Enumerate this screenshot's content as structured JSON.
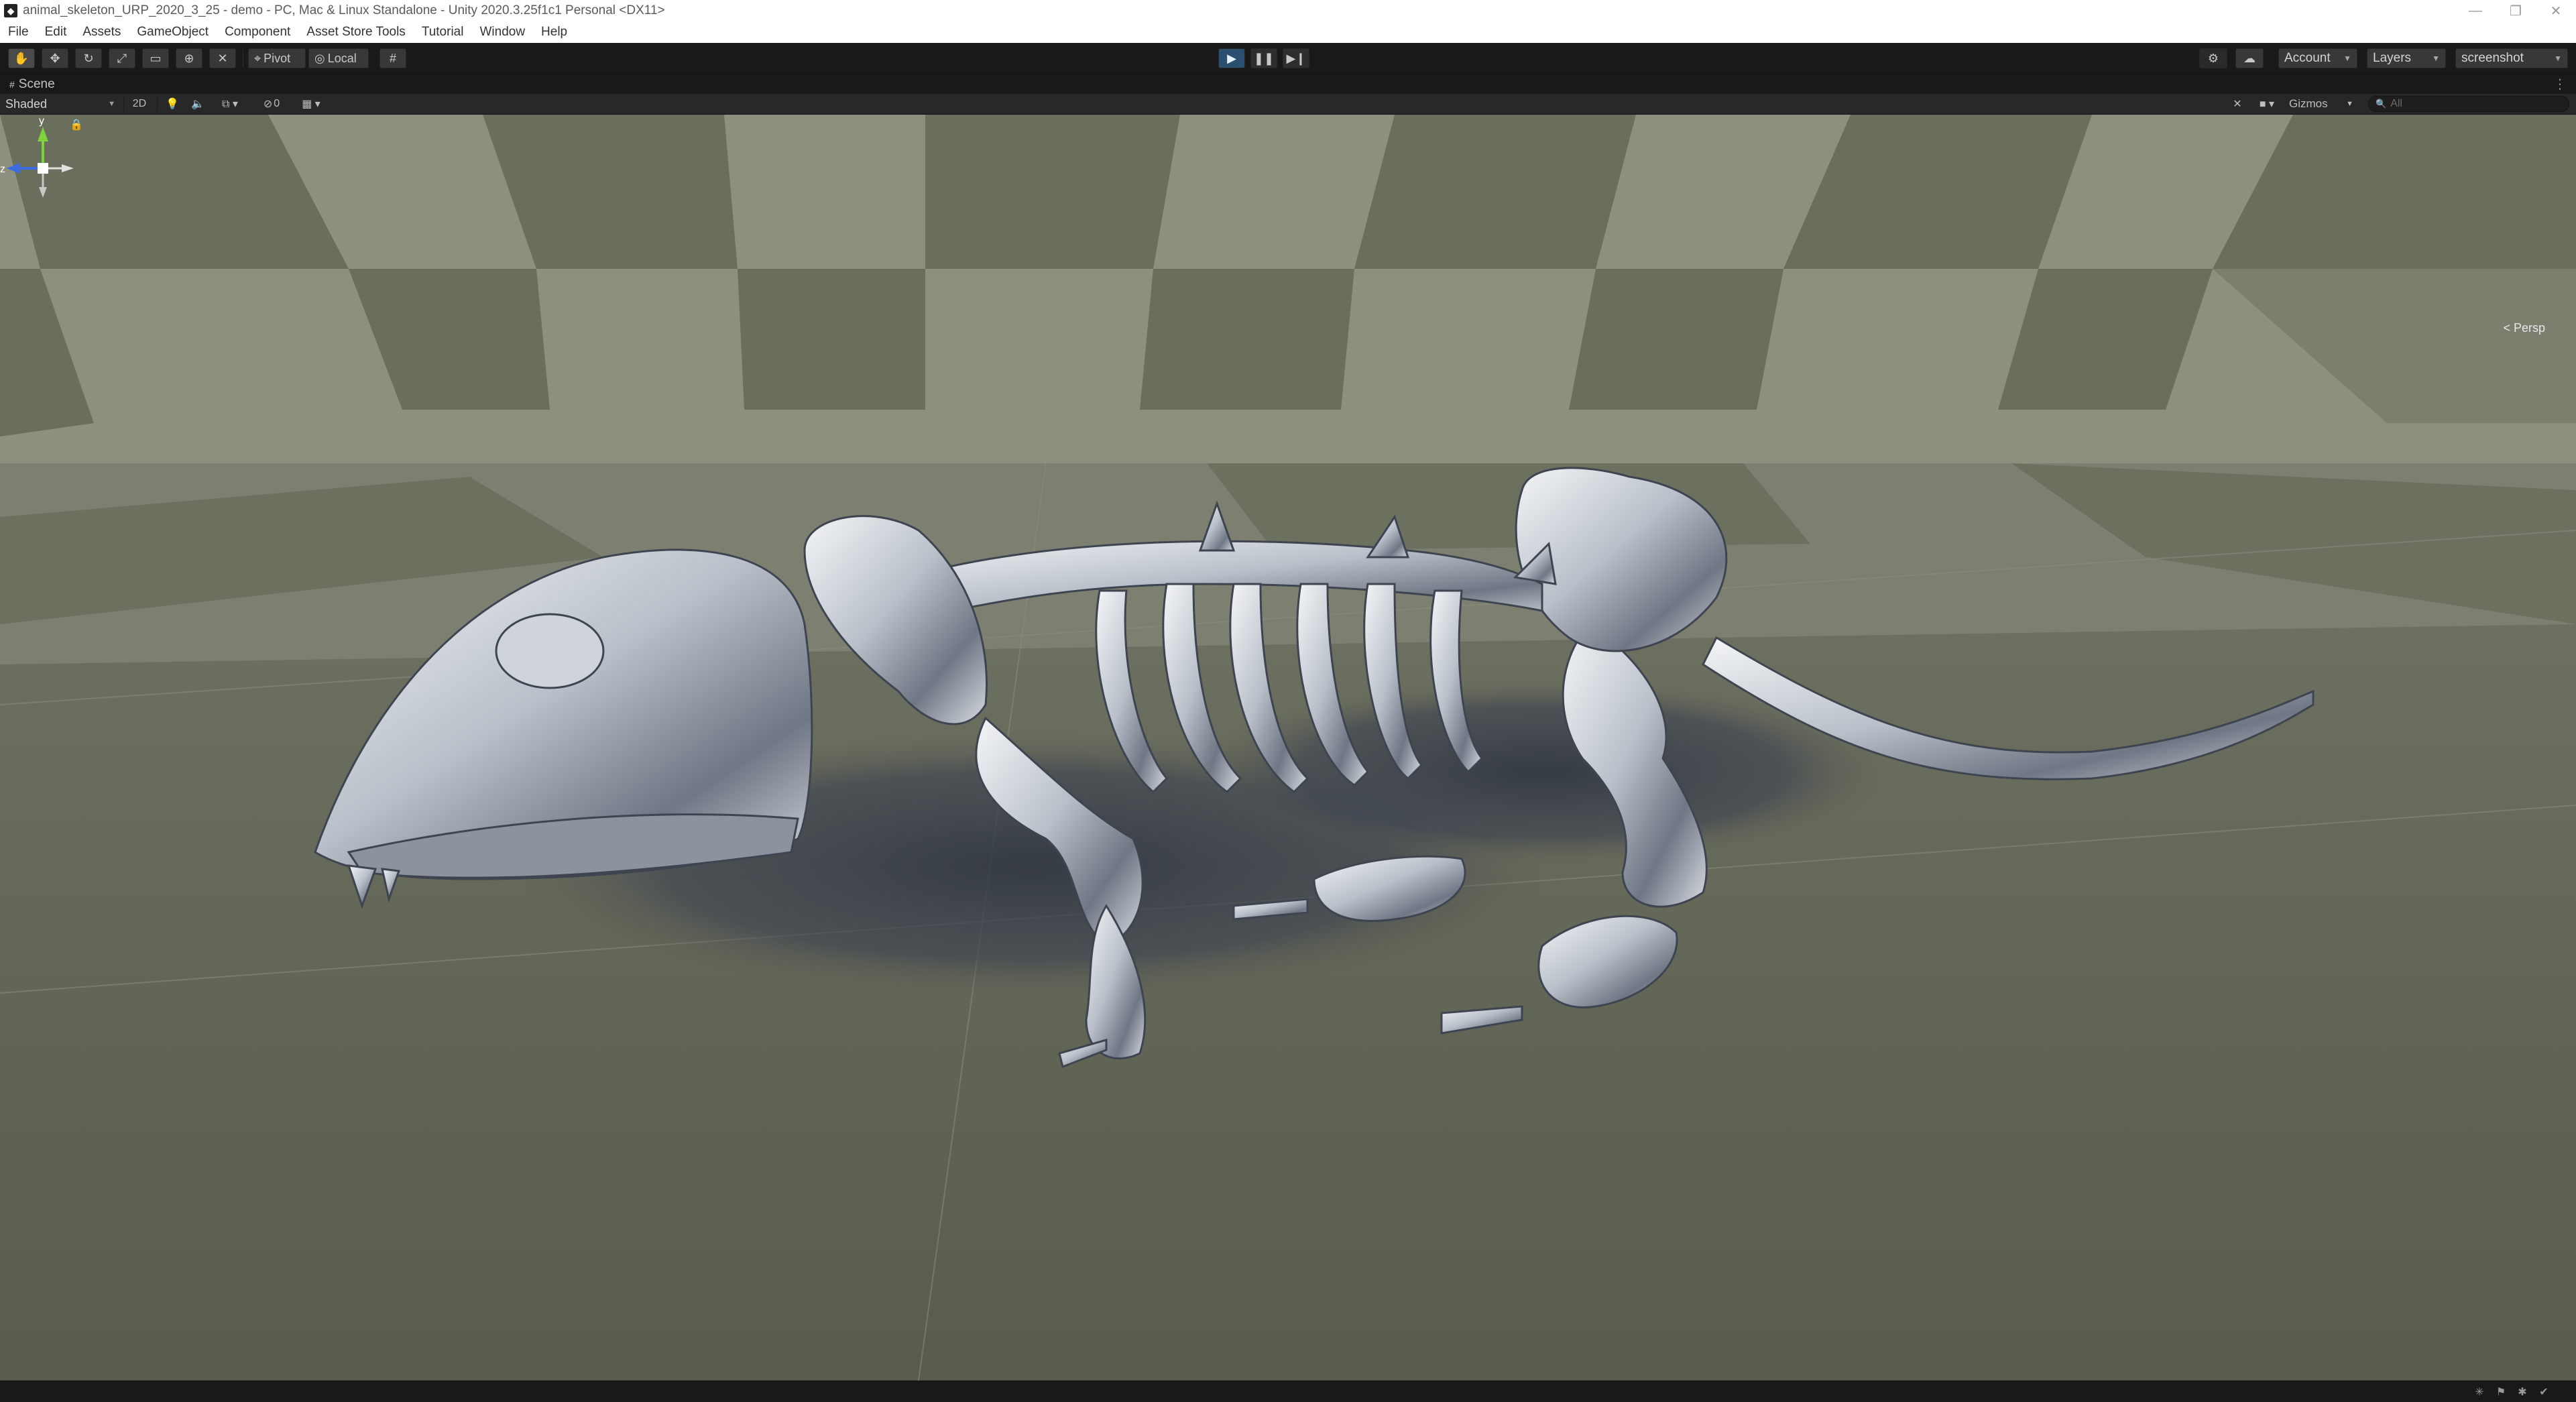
{
  "window": {
    "title": "animal_skeleton_URP_2020_3_25 - demo - PC, Mac & Linux Standalone - Unity 2020.3.25f1c1 Personal <DX11>",
    "controls": {
      "minimize": "—",
      "maximize": "❐",
      "close": "✕"
    }
  },
  "menu": [
    "File",
    "Edit",
    "Assets",
    "GameObject",
    "Component",
    "Asset Store Tools",
    "Tutorial",
    "Window",
    "Help"
  ],
  "toolbar": {
    "tools": [
      "hand-tool",
      "move-tool",
      "rotate-tool",
      "scale-tool",
      "rect-tool",
      "transform-tool",
      "custom-tool"
    ],
    "pivot_label": "Pivot",
    "local_label": "Local",
    "account_label": "Account",
    "layers_label": "Layers",
    "layout_label": "screenshot"
  },
  "scene": {
    "tab_label": "Scene",
    "shading_mode": "Shaded",
    "mode_2d": "2D",
    "hidden_count": "0",
    "gizmos_label": "Gizmos",
    "search_placeholder": "All",
    "projection_label": "< Persp",
    "axis_y": "y",
    "axis_z": "z"
  },
  "colors": {
    "play_active": "#2b4f6e",
    "axis_y": "#7cd33a",
    "axis_x": "#e04a3a",
    "axis_z": "#3a6be0",
    "floor_light": "#8a8d7c",
    "floor_dark": "#5f6353"
  }
}
